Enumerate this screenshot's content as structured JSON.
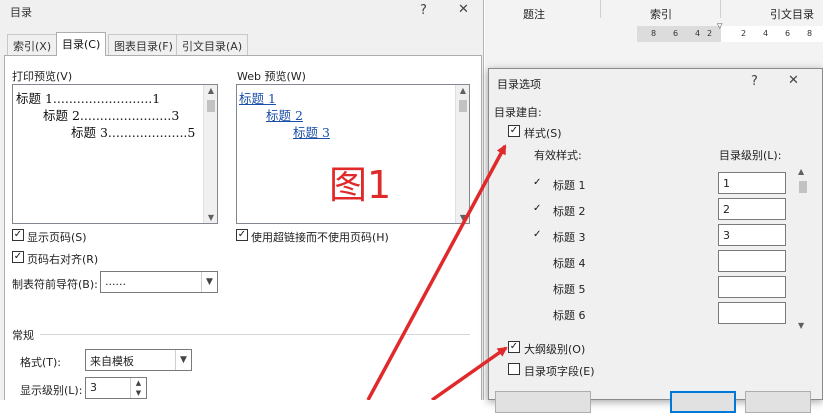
{
  "toc_dialog": {
    "title": "目录",
    "help_glyph": "?",
    "close_glyph": "✕",
    "tabs": [
      {
        "label": "索引(X)"
      },
      {
        "label": "目录(C)"
      },
      {
        "label": "图表目录(F)"
      },
      {
        "label": "引文目录(A)"
      }
    ],
    "print_preview": {
      "label": "打印预览(V)",
      "lines": [
        "标题 1.........................1",
        "标题 2.......................3",
        "标题 3....................5"
      ]
    },
    "web_preview": {
      "label": "Web 预览(W)",
      "links": [
        "标题 1",
        "标题 2",
        "标题 3"
      ]
    },
    "show_page_numbers": {
      "label": "显示页码(S)",
      "checked": true
    },
    "right_align": {
      "label": "页码右对齐(R)",
      "checked": true
    },
    "use_hyperlinks": {
      "label": "使用超链接而不使用页码(H)",
      "checked": true
    },
    "tab_leader": {
      "label": "制表符前导符(B):",
      "value": "......"
    },
    "general": {
      "heading": "常规",
      "format_label": "格式(T):",
      "format_value": "来自模板",
      "levels_label": "显示级别(L):",
      "levels_value": "3"
    }
  },
  "annotation": {
    "text": "图1",
    "color": "#e0292b"
  },
  "document": {
    "ribbon_tabs": [
      "题注",
      "索引",
      "引文目录"
    ],
    "ruler_numbers": [
      "8",
      "6",
      "4",
      "2",
      "2",
      "4",
      "6",
      "8"
    ]
  },
  "options_dialog": {
    "title": "目录选项",
    "help_glyph": "?",
    "close_glyph": "✕",
    "build_from": "目录建自:",
    "styles": {
      "label": "样式(S)",
      "checked": true
    },
    "col_available": "有效样式:",
    "col_level": "目录级别(L):",
    "rows": [
      {
        "name": "标题 1",
        "mark": "✓",
        "level": "1"
      },
      {
        "name": "标题 2",
        "mark": "✓",
        "level": "2"
      },
      {
        "name": "标题 3",
        "mark": "✓",
        "level": "3"
      },
      {
        "name": "标题 4",
        "mark": "",
        "level": ""
      },
      {
        "name": "标题 5",
        "mark": "",
        "level": ""
      },
      {
        "name": "标题 6",
        "mark": "",
        "level": ""
      }
    ],
    "outline_levels": {
      "label": "大纲级别(O)",
      "checked": true
    },
    "toc_fields": {
      "label": "目录项字段(E)",
      "checked": false
    }
  }
}
